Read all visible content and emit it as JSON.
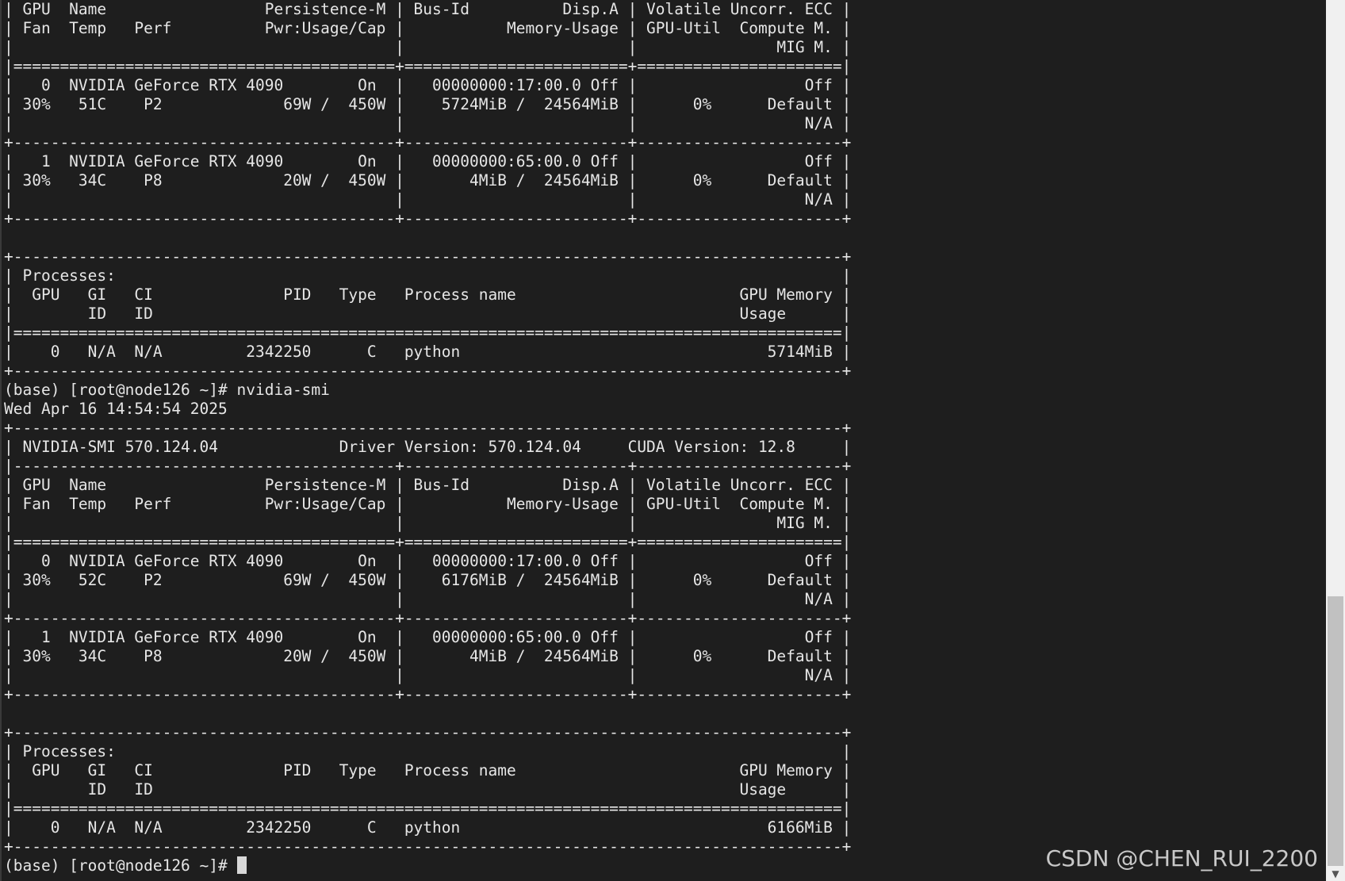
{
  "terminal": {
    "lines": [
      "| GPU  Name                 Persistence-M | Bus-Id          Disp.A | Volatile Uncorr. ECC |",
      "| Fan  Temp   Perf          Pwr:Usage/Cap |           Memory-Usage | GPU-Util  Compute M. |",
      "|                                         |                        |               MIG M. |",
      "|=========================================+========================+======================|",
      "|   0  NVIDIA GeForce RTX 4090        On  |   00000000:17:00.0 Off |                  Off |",
      "| 30%   51C    P2             69W /  450W |    5724MiB /  24564MiB |      0%      Default |",
      "|                                         |                        |                  N/A |",
      "+-----------------------------------------+------------------------+----------------------+",
      "|   1  NVIDIA GeForce RTX 4090        On  |   00000000:65:00.0 Off |                  Off |",
      "| 30%   34C    P8             20W /  450W |       4MiB /  24564MiB |      0%      Default |",
      "|                                         |                        |                  N/A |",
      "+-----------------------------------------+------------------------+----------------------+",
      "",
      "+-----------------------------------------------------------------------------------------+",
      "| Processes:                                                                              |",
      "|  GPU   GI   CI              PID   Type   Process name                        GPU Memory |",
      "|        ID   ID                                                               Usage      |",
      "|=========================================================================================|",
      "|    0   N/A  N/A         2342250      C   python                                 5714MiB |",
      "+-----------------------------------------------------------------------------------------+",
      "(base) [root@node126 ~]# nvidia-smi",
      "Wed Apr 16 14:54:54 2025",
      "+-----------------------------------------------------------------------------------------+",
      "| NVIDIA-SMI 570.124.04             Driver Version: 570.124.04     CUDA Version: 12.8     |",
      "|-----------------------------------------+------------------------+----------------------+",
      "| GPU  Name                 Persistence-M | Bus-Id          Disp.A | Volatile Uncorr. ECC |",
      "| Fan  Temp   Perf          Pwr:Usage/Cap |           Memory-Usage | GPU-Util  Compute M. |",
      "|                                         |                        |               MIG M. |",
      "|=========================================+========================+======================|",
      "|   0  NVIDIA GeForce RTX 4090        On  |   00000000:17:00.0 Off |                  Off |",
      "| 30%   52C    P2             69W /  450W |    6176MiB /  24564MiB |      0%      Default |",
      "|                                         |                        |                  N/A |",
      "+-----------------------------------------+------------------------+----------------------+",
      "|   1  NVIDIA GeForce RTX 4090        On  |   00000000:65:00.0 Off |                  Off |",
      "| 30%   34C    P8             20W /  450W |       4MiB /  24564MiB |      0%      Default |",
      "|                                         |                        |                  N/A |",
      "+-----------------------------------------+------------------------+----------------------+",
      "",
      "+-----------------------------------------------------------------------------------------+",
      "| Processes:                                                                              |",
      "|  GPU   GI   CI              PID   Type   Process name                        GPU Memory |",
      "|        ID   ID                                                               Usage      |",
      "|=========================================================================================|",
      "|    0   N/A  N/A         2342250      C   python                                 6166MiB |",
      "+-----------------------------------------------------------------------------------------+"
    ],
    "prompt": "(base) [root@node126 ~]# "
  },
  "watermark": {
    "text": "CSDN @CHEN_RUI_2200"
  },
  "colors": {
    "background": "#1e1e1e",
    "foreground": "#e6e6e6",
    "scrollbar_track": "#f0f0f0",
    "scrollbar_thumb": "#c1c1c1"
  },
  "scrollbar": {
    "position_fraction": 0.68
  }
}
